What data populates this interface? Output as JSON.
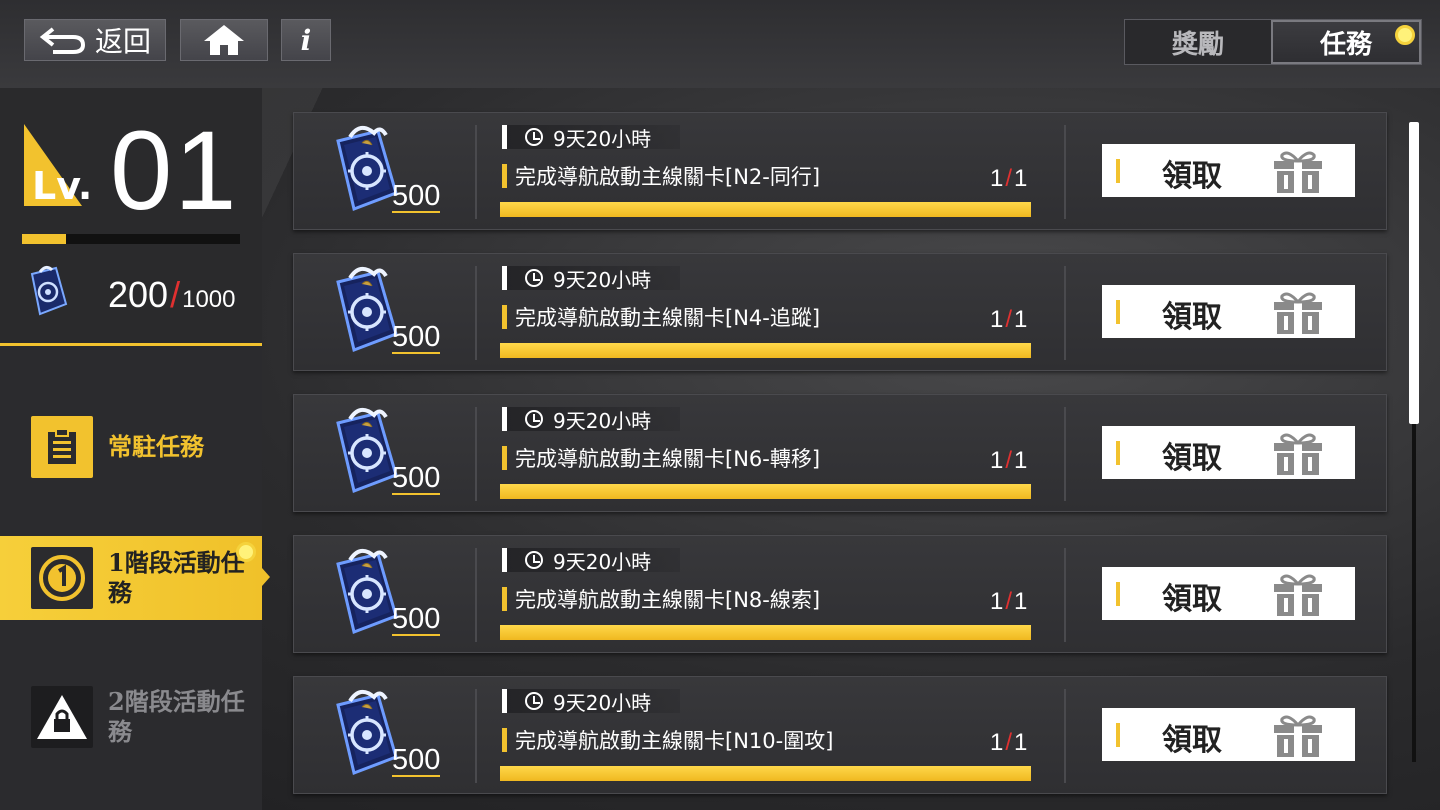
{
  "topbar": {
    "back_label": "返回",
    "home_icon": "home-icon",
    "info_label": "i"
  },
  "tabs": [
    {
      "label": "獎勵",
      "active": false
    },
    {
      "label": "任務",
      "active": true,
      "notify": true
    }
  ],
  "player": {
    "level_prefix": "Lv.",
    "level": "01",
    "xp_fraction": 0.2,
    "points": "200",
    "points_max": "1000"
  },
  "sidebar": {
    "items": [
      {
        "label": "常駐任務",
        "icon": "clipboard-icon",
        "state": "normal"
      },
      {
        "label": "1階段活動任務",
        "icon": "stage-one-icon",
        "state": "selected",
        "notify": true
      },
      {
        "label": "2階段活動任務",
        "icon": "lock-icon",
        "state": "locked"
      }
    ]
  },
  "missions": [
    {
      "reward": "500",
      "timer": "9天20小時",
      "task": "完成導航啟動主線關卡[N2-同行]",
      "progress": "1",
      "total": "1",
      "fraction": 1.0,
      "claim_label": "領取"
    },
    {
      "reward": "500",
      "timer": "9天20小時",
      "task": "完成導航啟動主線關卡[N4-追蹤]",
      "progress": "1",
      "total": "1",
      "fraction": 1.0,
      "claim_label": "領取"
    },
    {
      "reward": "500",
      "timer": "9天20小時",
      "task": "完成導航啟動主線關卡[N6-轉移]",
      "progress": "1",
      "total": "1",
      "fraction": 1.0,
      "claim_label": "領取"
    },
    {
      "reward": "500",
      "timer": "9天20小時",
      "task": "完成導航啟動主線關卡[N8-線索]",
      "progress": "1",
      "total": "1",
      "fraction": 1.0,
      "claim_label": "領取"
    },
    {
      "reward": "500",
      "timer": "9天20小時",
      "task": "完成導航啟動主線關卡[N10-圍攻]",
      "progress": "1",
      "total": "1",
      "fraction": 1.0,
      "claim_label": "領取"
    }
  ],
  "colors": {
    "accent": "#f2c22e",
    "slash": "#e03030"
  }
}
